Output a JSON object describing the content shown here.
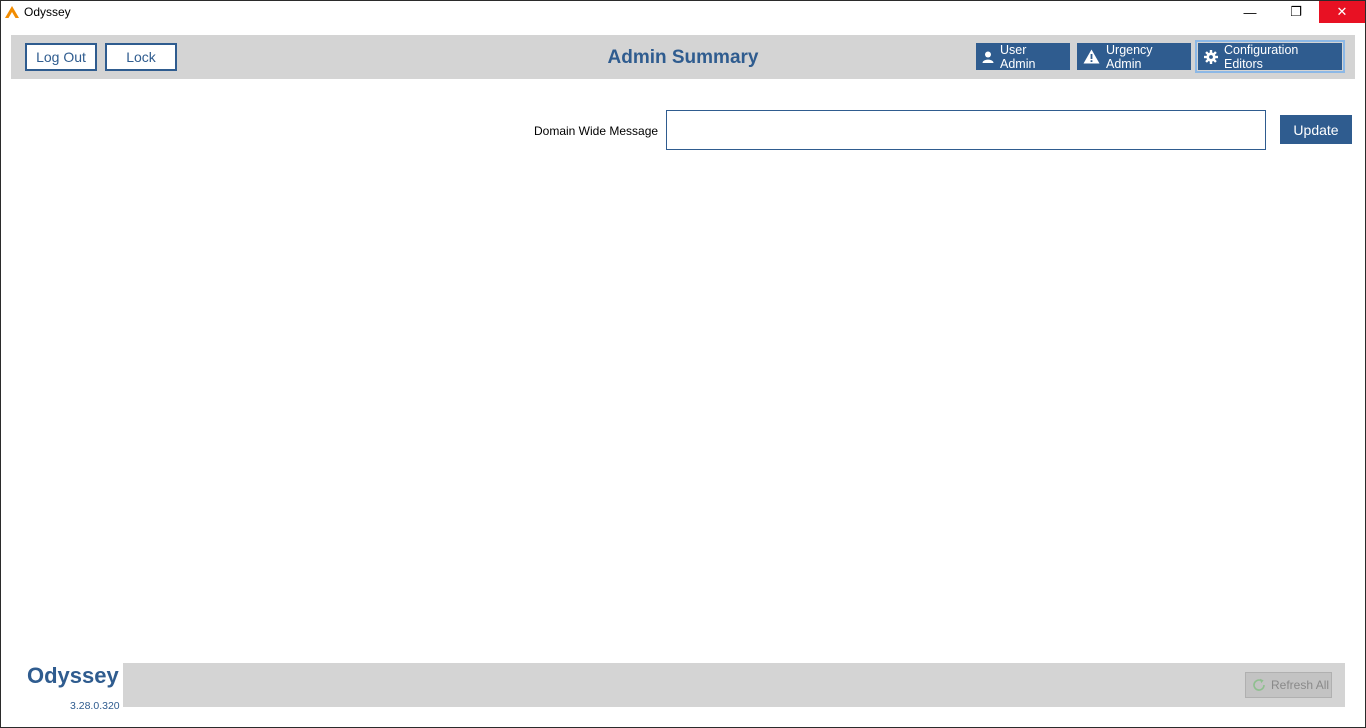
{
  "window": {
    "title": "Odyssey",
    "minimize_glyph": "—",
    "maximize_glyph": "❐",
    "close_glyph": "✕"
  },
  "header": {
    "logout_label": "Log Out",
    "lock_label": "Lock",
    "title": "Admin Summary",
    "user_admin_label": "User Admin",
    "urgency_admin_label": "Urgency Admin",
    "config_editors_label": "Configuration Editors"
  },
  "main": {
    "domain_message_label": "Domain Wide Message",
    "domain_message_value": "",
    "update_label": "Update"
  },
  "footer": {
    "brand": "Odyssey",
    "version": "3.28.0.320",
    "refresh_label": "Refresh All"
  },
  "icons": {
    "app": "app-logo-icon",
    "user": "user-icon",
    "warning": "warning-icon",
    "gear": "gear-icon",
    "refresh": "refresh-icon"
  },
  "colors": {
    "accent": "#2f5c8f",
    "bar": "#d4d4d4",
    "close": "#e81123",
    "focus_ring": "#8cb8e6",
    "logo": "#f28c00"
  }
}
